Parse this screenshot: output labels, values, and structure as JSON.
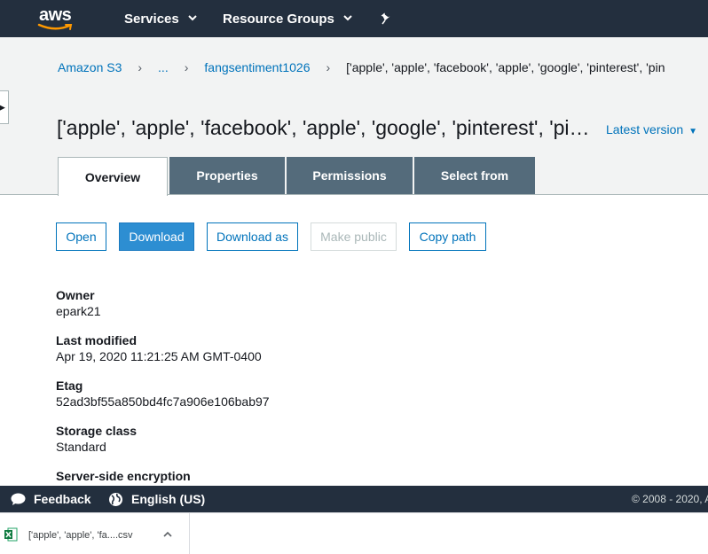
{
  "nav": {
    "logo_text": "aws",
    "services_label": "Services",
    "resource_groups_label": "Resource Groups"
  },
  "breadcrumb": {
    "root": "Amazon S3",
    "ellipsis": "...",
    "bucket": "fangsentiment1026",
    "current": "['apple', 'apple', 'facebook', 'apple', 'google', 'pinterest', 'pin"
  },
  "title": "['apple', 'apple', 'facebook', 'apple', 'google', 'pinterest', 'pi…",
  "version_label": "Latest version",
  "tabs": [
    {
      "label": "Overview",
      "active": true
    },
    {
      "label": "Properties",
      "active": false
    },
    {
      "label": "Permissions",
      "active": false
    },
    {
      "label": "Select from",
      "active": false
    }
  ],
  "actions": {
    "open": "Open",
    "download": "Download",
    "download_as": "Download as",
    "make_public": "Make public",
    "copy_path": "Copy path"
  },
  "properties": [
    {
      "label": "Owner",
      "value": "epark21"
    },
    {
      "label": "Last modified",
      "value": "Apr 19, 2020 11:21:25 AM GMT-0400"
    },
    {
      "label": "Etag",
      "value": "52ad3bf55a850bd4fc7a906e106bab97"
    },
    {
      "label": "Storage class",
      "value": "Standard"
    },
    {
      "label": "Server-side encryption",
      "value": ""
    }
  ],
  "footer": {
    "feedback": "Feedback",
    "language": "English (US)",
    "copyright": "© 2008 - 2020, A"
  },
  "download_bar": {
    "filename": "['apple', 'apple', 'fa....csv"
  },
  "colors": {
    "nav_bg": "#232f3e",
    "link": "#0073bb",
    "tab_inactive": "#546b7b",
    "primary_button": "#2d8ed2"
  }
}
